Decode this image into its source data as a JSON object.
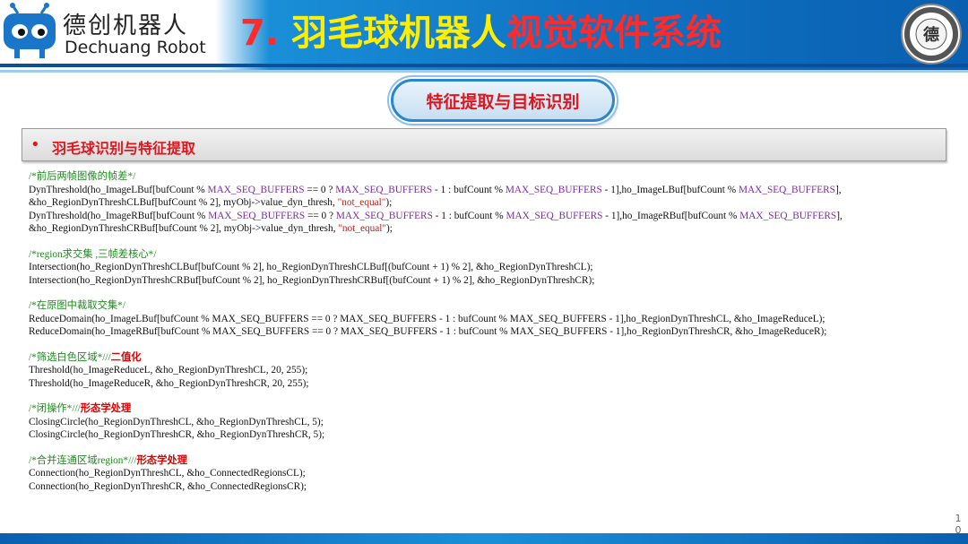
{
  "header": {
    "brand_cn": "德创机器人",
    "brand_en": "Dechuang Robot",
    "title_num": "7.",
    "title_part1": "羽毛球机器人",
    "title_part2": "视觉软件系统",
    "seal_text": "德"
  },
  "section_pill": "特征提取与目标识别",
  "subheading": {
    "bullet": "•",
    "text": "羽毛球识别与特征提取"
  },
  "code": {
    "g1": {
      "comment": "/*前后两帧图像的帧差*/",
      "l1": [
        "DynThreshold(ho_ImageLBuf[bufCount % ",
        "MAX_SEQ_BUFFERS",
        " == 0 ? ",
        "MAX_SEQ_BUFFERS",
        " - 1 : bufCount % ",
        "MAX_SEQ_BUFFERS",
        " - 1],ho_ImageLBuf[bufCount % ",
        "MAX_SEQ_BUFFERS",
        "],"
      ],
      "l2": [
        "&ho_RegionDynThreshCLBuf[bufCount % 2], myObj->value_dyn_thresh, ",
        "\"not_equal\"",
        ");"
      ],
      "l3": [
        "DynThreshold(ho_ImageRBuf[bufCount % ",
        "MAX_SEQ_BUFFERS",
        " == 0 ? ",
        "MAX_SEQ_BUFFERS",
        " - 1 : bufCount % ",
        "MAX_SEQ_BUFFERS",
        " - 1],ho_ImageRBuf[bufCount % ",
        "MAX_SEQ_BUFFERS",
        "],"
      ],
      "l4": [
        "&ho_RegionDynThreshCRBuf[bufCount % 2], myObj->value_dyn_thresh, ",
        "\"not_equal\"",
        ");"
      ]
    },
    "g2": {
      "comment": "/*region求交集 ,三帧差核心*/",
      "l1": "Intersection(ho_RegionDynThreshCLBuf[bufCount % 2], ho_RegionDynThreshCLBuf[(bufCount + 1) % 2], &ho_RegionDynThreshCL);",
      "l2": "Intersection(ho_RegionDynThreshCRBuf[bufCount % 2], ho_RegionDynThreshCRBuf[(bufCount + 1) % 2], &ho_RegionDynThreshCR);"
    },
    "g3": {
      "comment": "/*在原图中裁取交集*/",
      "l1": "ReduceDomain(ho_ImageLBuf[bufCount % MAX_SEQ_BUFFERS == 0 ? MAX_SEQ_BUFFERS - 1 : bufCount % MAX_SEQ_BUFFERS - 1],ho_RegionDynThreshCL, &ho_ImageReduceL);",
      "l2": "ReduceDomain(ho_ImageRBuf[bufCount % MAX_SEQ_BUFFERS == 0 ? MAX_SEQ_BUFFERS - 1 : bufCount % MAX_SEQ_BUFFERS - 1],ho_RegionDynThreshCR, &ho_ImageReduceR);"
    },
    "g4": {
      "comment": "/*筛选白色区域*///",
      "highlight": "二值化",
      "l1": "Threshold(ho_ImageReduceL, &ho_RegionDynThreshCL, 20, 255);",
      "l2": "Threshold(ho_ImageReduceR, &ho_RegionDynThreshCR, 20, 255);"
    },
    "g5": {
      "comment": "/*闭操作*///",
      "highlight": "形态学处理",
      "l1": "ClosingCircle(ho_RegionDynThreshCL, &ho_RegionDynThreshCL, 5);",
      "l2": "ClosingCircle(ho_RegionDynThreshCR, &ho_RegionDynThreshCR, 5);"
    },
    "g6": {
      "comment": "/*合并连通区域region*///",
      "highlight": "形态学处理",
      "l1": "Connection(ho_RegionDynThreshCL, &ho_ConnectedRegionsCL);",
      "l2": "Connection(ho_RegionDynThreshCR, &ho_ConnectedRegionsCR);"
    }
  },
  "page_number": [
    "1",
    "0"
  ],
  "colors": {
    "header_blue": "#0f73c4",
    "title_yellow": "#ffee00",
    "title_red": "#ff2a2a",
    "comment_green": "#1e8a1e",
    "macro_purple": "#7a2c9e"
  }
}
